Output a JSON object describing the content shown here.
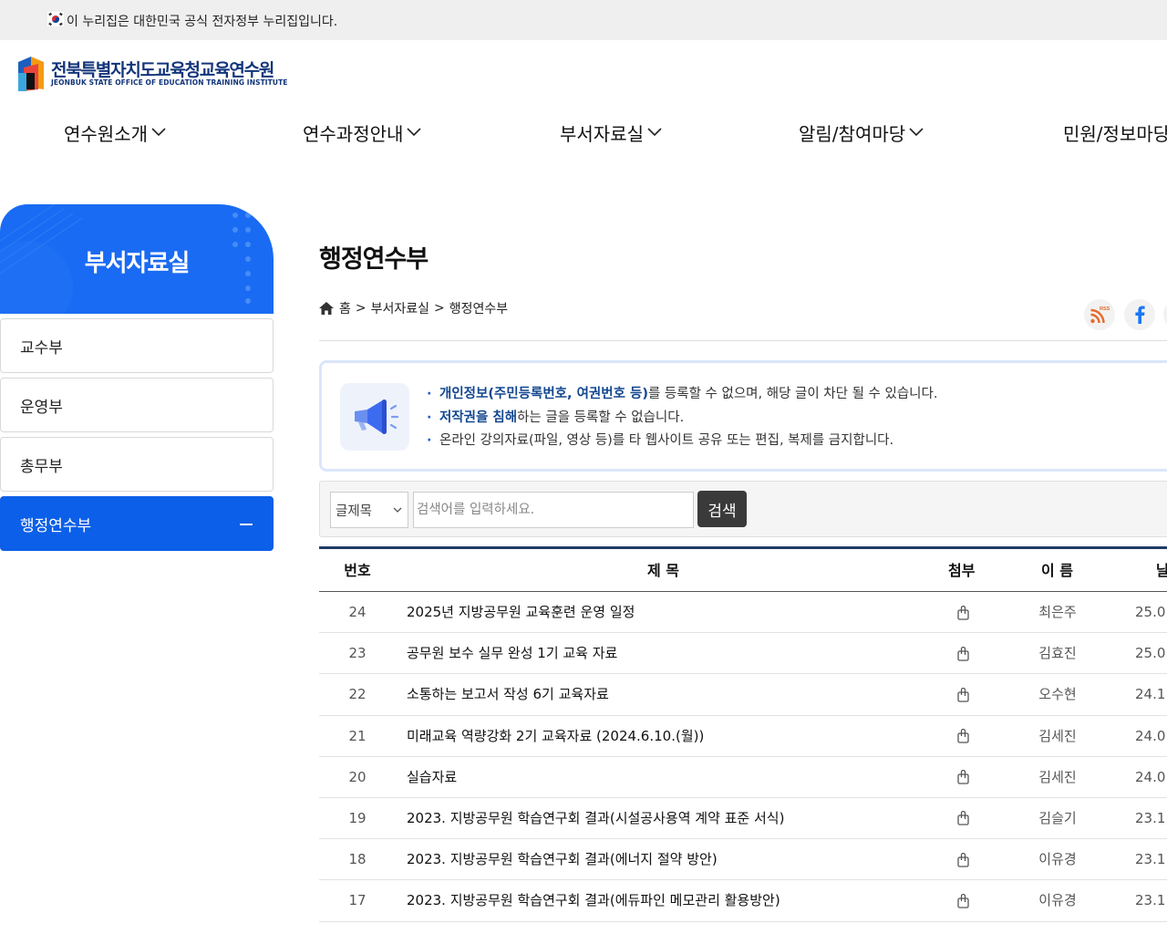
{
  "gov_banner": {
    "text": "이 누리집은 대한민국 공식 전자정부 누리집입니다."
  },
  "logo": {
    "name_kr": "전북특별자치도교육청교육연수원",
    "name_en": "JEONBUK STATE OFFICE OF EDUCATION TRAINING INSTITUTE"
  },
  "gnb": {
    "items": [
      {
        "label": "연수원소개"
      },
      {
        "label": "연수과정안내"
      },
      {
        "label": "부서자료실"
      },
      {
        "label": "알림/참여마당"
      },
      {
        "label": "민원/정보마당"
      }
    ]
  },
  "lnb": {
    "title": "부서자료실",
    "items": [
      {
        "label": "교수부"
      },
      {
        "label": "운영부"
      },
      {
        "label": "총무부"
      },
      {
        "label": "행정연수부"
      }
    ]
  },
  "page": {
    "title": "행정연수부"
  },
  "breadcrumb": {
    "home": "홈",
    "separator": ">",
    "level1": "부서자료실",
    "level2": "행정연수부"
  },
  "share": {
    "rss_label": "RSS"
  },
  "notice": {
    "line1_em": "개인정보(주민등록번호, 여권번호 등)",
    "line1_rest": "를 등록할 수 없으며, 해당 글이 차단 될 수 있습니다.",
    "line2_em": "저작권을 침해",
    "line2_rest": "하는 글을 등록할 수 없습니다.",
    "line3": "온라인 강의자료(파일, 영상 등)를 타 웹사이트 공유 또는 편집, 복제를 금지합니다."
  },
  "search": {
    "select_value": "글제목",
    "placeholder": "검색어를 입력하세요.",
    "button_label": "검색"
  },
  "board": {
    "headers": {
      "no": "번호",
      "title": "제 목",
      "file": "첨부",
      "name": "이 름",
      "date": "날"
    },
    "rows": [
      {
        "no": "24",
        "title": "2025년 지방공무원 교육훈련 운영 일정",
        "name": "최은주",
        "date": "25.0"
      },
      {
        "no": "23",
        "title": "공무원 보수 실무 완성 1기 교육 자료",
        "name": "김효진",
        "date": "25.0"
      },
      {
        "no": "22",
        "title": "소통하는 보고서 작성 6기 교육자료",
        "name": "오수현",
        "date": "24.1"
      },
      {
        "no": "21",
        "title": "미래교육 역량강화 2기 교육자료 (2024.6.10.(월))",
        "name": "김세진",
        "date": "24.0"
      },
      {
        "no": "20",
        "title": "실습자료",
        "name": "김세진",
        "date": "24.0"
      },
      {
        "no": "19",
        "title": "2023. 지방공무원 학습연구회 결과(시설공사용역 계약 표준 서식)",
        "name": "김슬기",
        "date": "23.1"
      },
      {
        "no": "18",
        "title": "2023. 지방공무원 학습연구회 결과(에너지 절약 방안)",
        "name": "이유경",
        "date": "23.1"
      },
      {
        "no": "17",
        "title": "2023. 지방공무원 학습연구회 결과(에듀파인 메모관리 활용방안)",
        "name": "이유경",
        "date": "23.1"
      }
    ]
  },
  "colors": {
    "primary_blue": "#1a6bf3",
    "active_blue": "#0c5fe8",
    "logo_navy": "#12357a",
    "board_top_border": "#1f3c66",
    "search_button": "#3a3a3a"
  }
}
